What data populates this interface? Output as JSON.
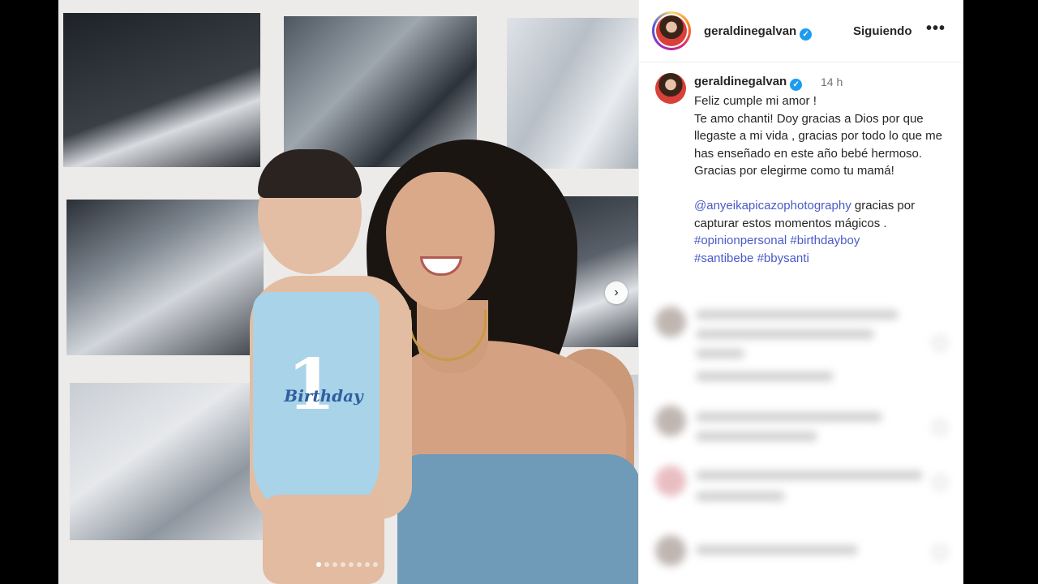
{
  "post": {
    "username": "geraldinegalvan",
    "verified_mark": "✓",
    "follow_label": "Siguiendo",
    "more_label": "•••",
    "time": "14 h",
    "caption_lines": [
      "Feliz cumple mi amor !",
      "Te amo chanti! Doy gracias a Dios  por que llegaste a mi vida , gracias por todo lo que me has enseñado en este año bebé hermoso. Gracias por elegirme como tu mamá!"
    ],
    "mention": "@anyeikapicazophotography",
    "mention_suffix": "  gracias por capturar estos momentos mágicos .",
    "hashtags_line1": "#opinionpersonal #birthdayboy",
    "hashtags_line2": "#santibebe #bbysanti"
  },
  "photo": {
    "romper_number": "1",
    "romper_text": "Birthday",
    "next_icon": "›",
    "carousel_total": 8,
    "carousel_active": 1
  },
  "colors": {
    "link": "#4a5ac9",
    "verified": "#1d9bf0",
    "text": "#262626",
    "muted": "#737373"
  },
  "icons": [
    "verified-icon",
    "more-icon",
    "chevron-right-icon"
  ]
}
